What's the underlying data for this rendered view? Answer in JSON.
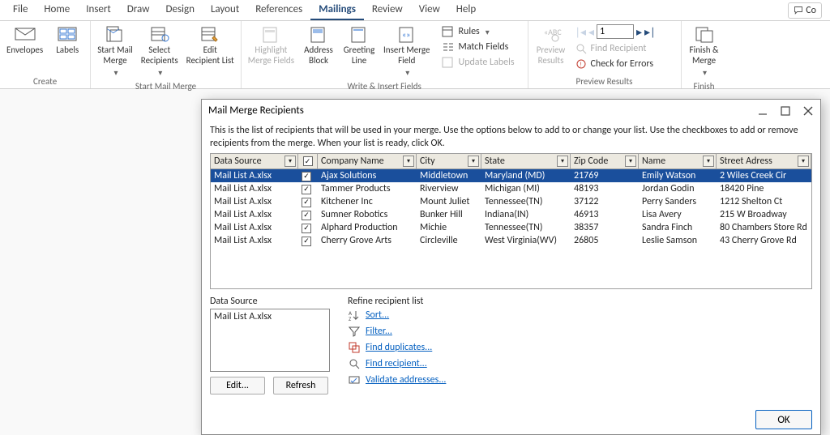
{
  "tabs": [
    "File",
    "Home",
    "Insert",
    "Draw",
    "Design",
    "Layout",
    "References",
    "Mailings",
    "Review",
    "View",
    "Help"
  ],
  "active_tab": "Mailings",
  "comments_label": "Co",
  "ribbon": {
    "groups": {
      "create": {
        "label": "Create",
        "envelopes": "Envelopes",
        "labels": "Labels"
      },
      "start": {
        "label": "Start Mail Merge",
        "start": "Start Mail\nMerge",
        "select": "Select\nRecipients",
        "edit": "Edit\nRecipient List"
      },
      "write": {
        "label": "Write & Insert Fields",
        "highlight": "Highlight\nMerge Fields",
        "address": "Address\nBlock",
        "greeting": "Greeting\nLine",
        "insert": "Insert Merge\nField",
        "rules": "Rules",
        "match": "Match Fields",
        "update": "Update Labels"
      },
      "preview": {
        "label": "Preview Results",
        "preview": "Preview\nResults",
        "record": "1",
        "find": "Find Recipient",
        "check": "Check for Errors"
      },
      "finish": {
        "label": "Finish",
        "finish": "Finish &\nMerge"
      }
    }
  },
  "dialog": {
    "title": "Mail Merge Recipients",
    "instructions": "This is the list of recipients that will be used in your merge.  Use the options below to add to or change your list.  Use the checkboxes to add or remove recipients from the merge.  When your list is ready, click OK.",
    "columns": [
      "Data Source",
      "",
      "Company Name",
      "City",
      "State",
      "Zip Code",
      "Name",
      "Street Adress"
    ],
    "rows": [
      {
        "ds": "Mail List A.xlsx",
        "chk": true,
        "company": "Ajax Solutions",
        "city": "Middletown",
        "state": "Maryland (MD)",
        "zip": "21769",
        "name": "Emily Watson",
        "addr": "2 Wiles Creek Cir"
      },
      {
        "ds": "Mail List A.xlsx",
        "chk": true,
        "company": "Tammer Products",
        "city": "Riverview",
        "state": "Michigan (MI)",
        "zip": "48193",
        "name": "Jordan Godin",
        "addr": "18420 Pine"
      },
      {
        "ds": "Mail List A.xlsx",
        "chk": true,
        "company": "Kitchener Inc",
        "city": "Mount Juliet",
        "state": "Tennessee(TN)",
        "zip": "37122",
        "name": "Perry Sanders",
        "addr": "1212 Shelton Ct"
      },
      {
        "ds": "Mail List A.xlsx",
        "chk": true,
        "company": "Sumner Robotics",
        "city": "Bunker Hill",
        "state": "Indiana(IN)",
        "zip": "46913",
        "name": "Lisa Avery",
        "addr": "215 W Broadway"
      },
      {
        "ds": "Mail List A.xlsx",
        "chk": true,
        "company": "Alphard Production",
        "city": "Michie",
        "state": "Tennessee(TN)",
        "zip": "38357",
        "name": "Sandra Finch",
        "addr": "80 Chambers Store Rd"
      },
      {
        "ds": "Mail List A.xlsx",
        "chk": true,
        "company": "Cherry Grove Arts",
        "city": "Circleville",
        "state": "West Virginia(WV)",
        "zip": "26805",
        "name": "Leslie Samson",
        "addr": "43 Cherry Grove Rd"
      }
    ],
    "data_source_label": "Data Source",
    "data_source_item": "Mail List A.xlsx",
    "edit_btn": "Edit...",
    "refresh_btn": "Refresh",
    "refine_label": "Refine recipient list",
    "refine": {
      "sort": "Sort...",
      "filter": "Filter...",
      "dup": "Find duplicates...",
      "find": "Find recipient...",
      "validate": "Validate addresses..."
    },
    "ok": "OK"
  }
}
